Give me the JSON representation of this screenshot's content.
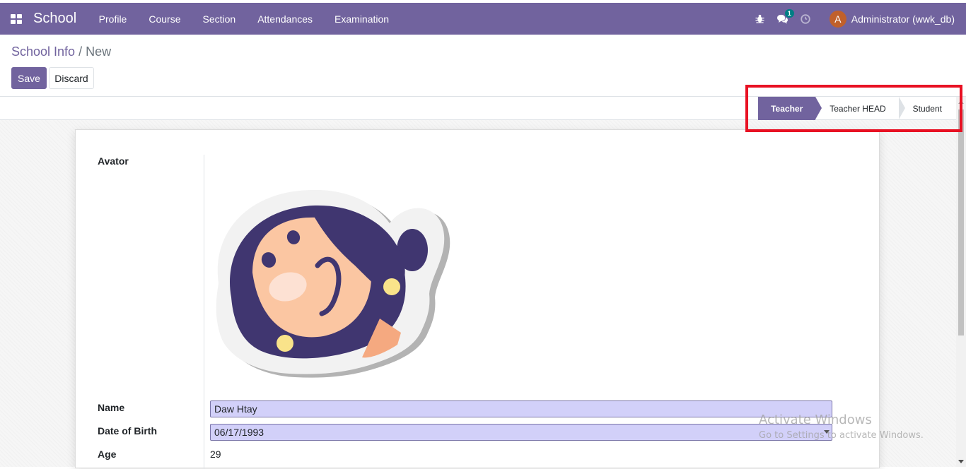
{
  "app": {
    "brand": "School",
    "menu": [
      "Profile",
      "Course",
      "Section",
      "Attendances",
      "Examination"
    ],
    "systray": {
      "messages_count": "1",
      "user_initial": "A",
      "user_name": "Administrator (wwk_db)"
    },
    "colors": {
      "brand": "#71639e",
      "field_bg": "#d2d0f9",
      "highlight": "#e81123"
    }
  },
  "breadcrumb": {
    "parent": "School Info",
    "separator": "/",
    "current": "New"
  },
  "buttons": {
    "save": "Save",
    "discard": "Discard"
  },
  "statusbar": {
    "stages": [
      "Teacher",
      "Teacher HEAD",
      "Student"
    ],
    "active": "Teacher"
  },
  "form": {
    "avatar_label": "Avator",
    "name_label": "Name",
    "name_value": "Daw Htay",
    "dob_label": "Date of Birth",
    "dob_value": "06/17/1993",
    "age_label": "Age",
    "age_value": "29"
  },
  "watermark": {
    "title": "Activate Windows",
    "subtitle": "Go to Settings to activate Windows."
  }
}
